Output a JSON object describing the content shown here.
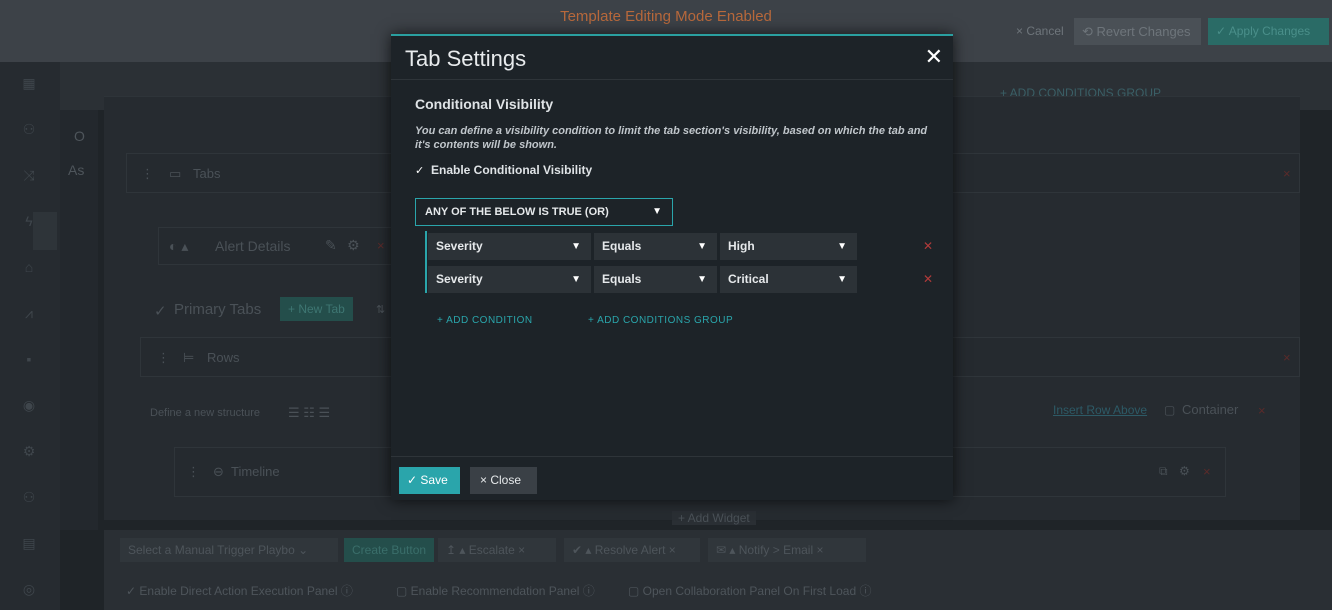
{
  "topbar": {
    "title": "Template Editing Mode Enabled",
    "cancel": "× Cancel",
    "revert": "⟲ Revert Changes",
    "apply": "✓ Apply Changes"
  },
  "background": {
    "sub_label_o": "O",
    "sub_label_as": "As",
    "tabs_label": "Tabs",
    "alert_details": "Alert Details",
    "primary_tabs": "Primary Tabs",
    "new_tab": "+ New Tab",
    "rows_label": "Rows",
    "define_structure": "Define a new structure",
    "insert_row_above": "Insert Row Above",
    "container": "Container",
    "timeline": "Timeline",
    "add_widget": "+ Add Widget",
    "add_conditions_group_bg": "+ ADD CONDITIONS GROUP"
  },
  "bottom_bar": {
    "trigger_select": "Select a Manual Trigger Playbo",
    "create_button": "Create Button",
    "escalate": "Escalate",
    "resolve_alert": "Resolve Alert",
    "notify_email": "Notify > Email",
    "enable_direct": "Enable Direct Action Execution Panel",
    "enable_reco": "Enable Recommendation Panel",
    "open_collab": "Open Collaboration Panel On First Load"
  },
  "modal": {
    "title": "Tab Settings",
    "close_glyph": "✕",
    "section_title": "Conditional Visibility",
    "description": "You can define a visibility condition to limit the tab section's visibility, based on which the tab and it's contents will be shown.",
    "enable_label": "Enable Conditional Visibility",
    "enable_checked": true,
    "operator": "ANY OF THE BELOW IS TRUE (OR)",
    "conditions": [
      {
        "field": "Severity",
        "op": "Equals",
        "value": "High"
      },
      {
        "field": "Severity",
        "op": "Equals",
        "value": "Critical"
      }
    ],
    "add_condition": "+ ADD CONDITION",
    "add_group": "+ ADD CONDITIONS GROUP",
    "save": "✓ Save",
    "close": "× Close"
  },
  "colors": {
    "accent": "#2aa5ab",
    "modal_bg": "#1d2328",
    "danger": "#b03a3a",
    "editing_banner": "#b8693c"
  }
}
